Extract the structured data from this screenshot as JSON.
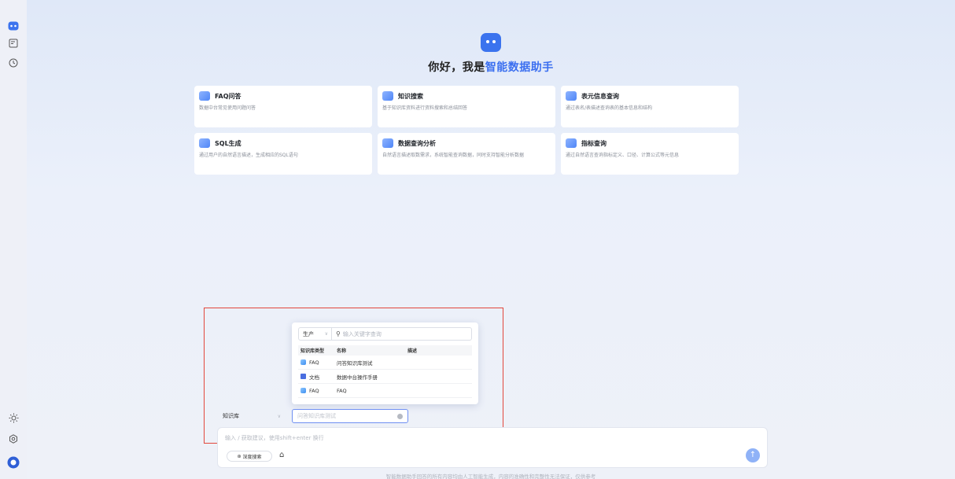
{
  "sidebar": {
    "icons": [
      "chat-bot-icon",
      "new-chat-icon",
      "history-icon",
      "theme-sun-icon",
      "settings-icon",
      "avatar-icon"
    ]
  },
  "hero": {
    "greeting": "你好，我是",
    "assistant_name": "智能数据助手"
  },
  "cards": [
    {
      "title": "FAQ问答",
      "desc": "数据中台常见使用问题问答"
    },
    {
      "title": "知识搜索",
      "desc": "基于知识库资料进行资料搜索和总结回答"
    },
    {
      "title": "表元信息查询",
      "desc": "通过表名/表描述查询表的基本信息和结构"
    },
    {
      "title": "SQL生成",
      "desc": "通过用户的自然语言描述，生成相应的SQL语句"
    },
    {
      "title": "数据查询分析",
      "desc": "自然语言描述取数需求，系统智能查询数据，同时支持智能分析数据"
    },
    {
      "title": "指标查询",
      "desc": "通过自然语言查询指标定义、口径、计算公式等元信息"
    }
  ],
  "popup": {
    "env_value": "生产",
    "search_placeholder": "输入关键字查询",
    "columns": [
      "知识库类型",
      "名称",
      "描述"
    ],
    "rows": [
      {
        "type": "FAQ",
        "name": "问答知识库测试",
        "desc": ""
      },
      {
        "type": "文档",
        "name": "数据中台操作手册",
        "desc": ""
      },
      {
        "type": "FAQ",
        "name": "FAQ",
        "desc": ""
      }
    ]
  },
  "input_bar": {
    "kb_select_value": "知识库",
    "kb_input_placeholder": "问答知识库测试",
    "chat_placeholder": "输入 / 获取建议，使用shift+enter 换行",
    "deep_search_label": "深度搜索"
  },
  "footer": {
    "disclaimer": "智能数据助手回答的所有内容均由人工智能生成，内容的准确性和完整性无法保证，仅供参考"
  },
  "colors": {
    "accent": "#3b6ff0",
    "highlight_border": "#e2473c"
  }
}
